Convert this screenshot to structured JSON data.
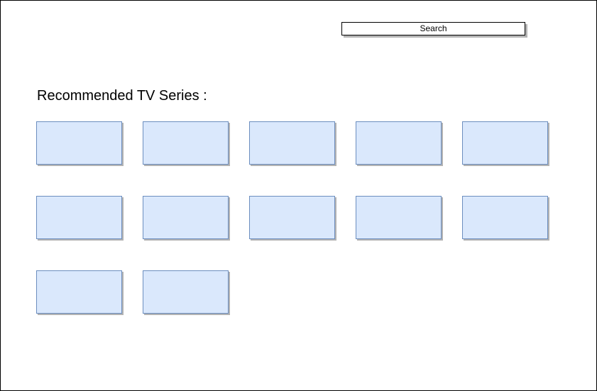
{
  "header": {
    "search_label": "Search"
  },
  "recommended": {
    "title": "Recommended TV Series :",
    "card_count": 12
  },
  "colors": {
    "card_fill": "#dae8fc",
    "card_border": "#6c8ebf",
    "shadow": "#b3b3b3",
    "frame_border": "#000000"
  }
}
